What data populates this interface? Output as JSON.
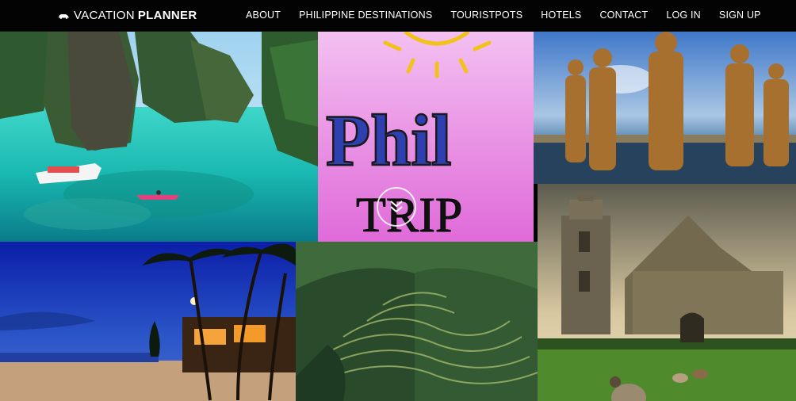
{
  "brand": {
    "icon": "car-icon",
    "light_text": "VACATION",
    "bold_text": "PLANNER"
  },
  "nav": {
    "items": [
      {
        "label": "ABOUT"
      },
      {
        "label": "PHILIPPINE DESTINATIONS"
      },
      {
        "label": "TOURISTPOTS"
      },
      {
        "label": "HOTELS"
      },
      {
        "label": "CONTACT"
      },
      {
        "label": "LOG IN"
      },
      {
        "label": "SIGN UP"
      }
    ]
  },
  "hero": {
    "logo_word": "Phil",
    "logo_sub": "TRIP",
    "scroll_icon": "double-chevron-down-icon"
  },
  "colors": {
    "nav_bg": "#030303",
    "logo_bg": "#e98fe6"
  }
}
